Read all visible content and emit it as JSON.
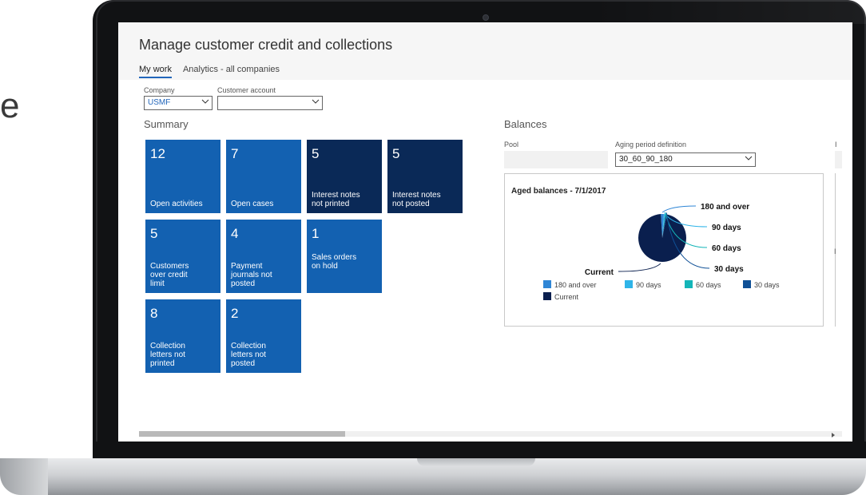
{
  "slide": {
    "left_letter": "e"
  },
  "app": {
    "title": "Manage customer credit and collections",
    "tabs": [
      {
        "label": "My work",
        "active": true
      },
      {
        "label": "Analytics - all companies",
        "active": false
      }
    ],
    "filters": {
      "company_label": "Company",
      "company_value": "USMF",
      "customer_label": "Customer account",
      "customer_value": ""
    },
    "summary": {
      "title": "Summary",
      "tiles": [
        {
          "count": "12",
          "label": "Open activities",
          "style": "blue"
        },
        {
          "count": "7",
          "label": "Open cases",
          "style": "blue"
        },
        {
          "count": "5",
          "label": "Interest notes\nnot printed",
          "style": "dark"
        },
        {
          "count": "5",
          "label": "Interest notes\nnot posted",
          "style": "dark"
        },
        {
          "count": "5",
          "label": "Customers\nover credit\nlimit",
          "style": "blue"
        },
        {
          "count": "4",
          "label": "Payment\njournals not\nposted",
          "style": "blue"
        },
        {
          "count": "1",
          "label": "Sales orders\non hold",
          "style": "blue"
        },
        {
          "count": "8",
          "label": "Collection\nletters not\nprinted",
          "style": "blue"
        },
        {
          "count": "2",
          "label": "Collection\nletters not\nposted",
          "style": "blue"
        }
      ]
    },
    "balances": {
      "title": "Balances",
      "pool_label": "Pool",
      "aging_label": "Aging period definition",
      "aging_value": "30_60_90_180"
    }
  },
  "chart_data": {
    "type": "pie",
    "title": "Aged balances - 7/1/2017",
    "legend_position": "bottom",
    "categories": [
      "180 and over",
      "90 days",
      "60 days",
      "30 days",
      "Current"
    ],
    "values": [
      2,
      0.6,
      0.6,
      0.8,
      96
    ],
    "colors": [
      "#2f86d6",
      "#2fb4e8",
      "#14b5b8",
      "#0f5096",
      "#0a1f4e"
    ],
    "callout_labels": [
      "180 and over",
      "90 days",
      "60 days",
      "30 days",
      "Current"
    ]
  },
  "colors": {
    "tile_blue": "#1361b1",
    "tile_dark": "#0a2957",
    "accent": "#2266bb"
  }
}
